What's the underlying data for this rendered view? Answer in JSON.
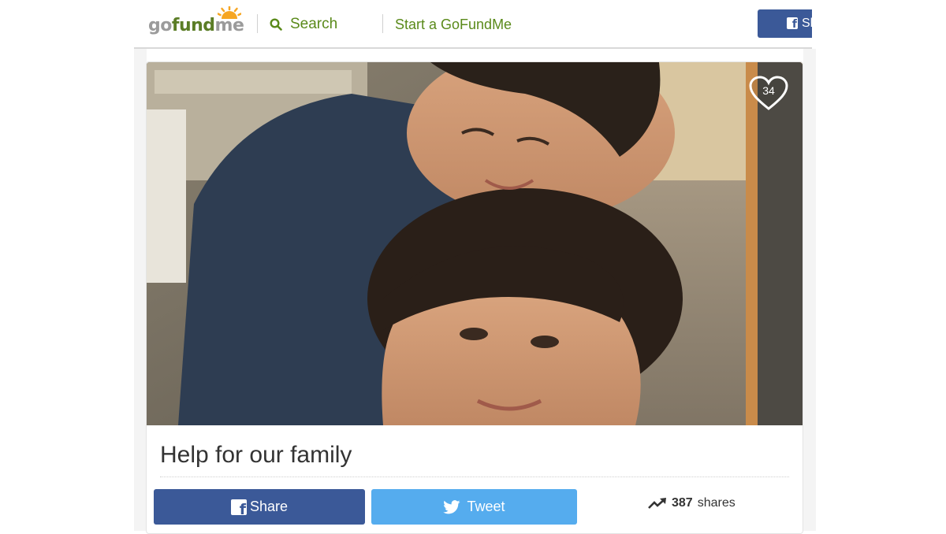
{
  "header": {
    "logo": {
      "go": "go",
      "fund": "fund",
      "me": "me"
    },
    "search_label": "Search",
    "start_label": "Start a GoFundMe",
    "share_label": "Sh"
  },
  "campaign": {
    "heart_count": "34",
    "title": "Help for our family",
    "photo_alt": "Campaign photo"
  },
  "actions": {
    "facebook_label": "Share",
    "twitter_label": "Tweet",
    "shares_count": "387",
    "shares_suffix": "shares"
  },
  "colors": {
    "brand_green": "#5a8a1a",
    "facebook_blue": "#3b5998",
    "twitter_blue": "#55acee",
    "logo_sun": "#f6a623"
  },
  "icons": {
    "search": "search-icon",
    "facebook": "facebook-icon",
    "twitter": "twitter-icon",
    "heart": "heart-icon",
    "trending": "trending-up-icon"
  }
}
